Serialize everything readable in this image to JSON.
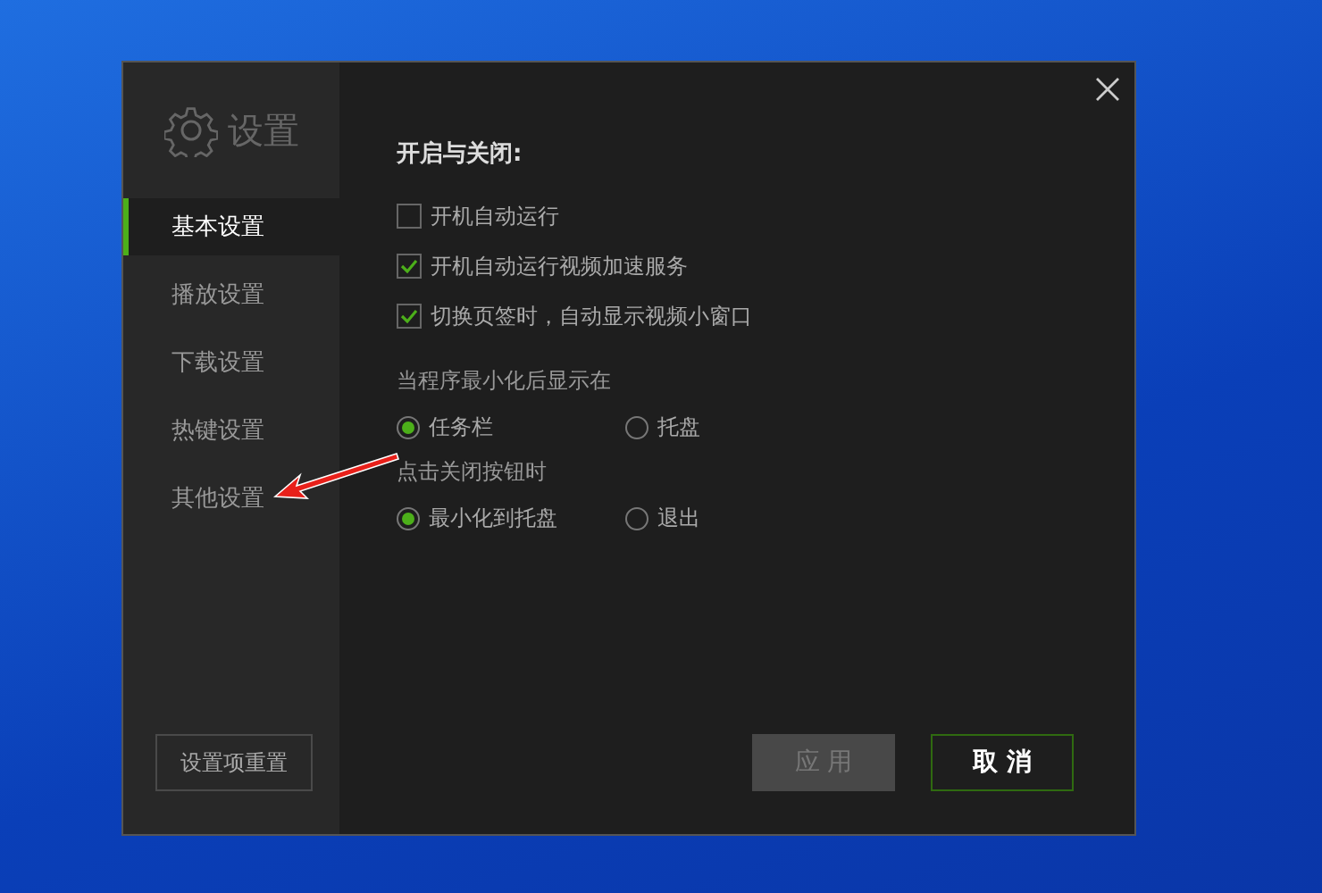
{
  "sidebar": {
    "title": "设置",
    "items": [
      {
        "label": "基本设置",
        "selected": true
      },
      {
        "label": "播放设置",
        "selected": false
      },
      {
        "label": "下载设置",
        "selected": false
      },
      {
        "label": "热键设置",
        "selected": false
      },
      {
        "label": "其他设置",
        "selected": false
      }
    ],
    "reset_button": "设置项重置"
  },
  "section_title": "开启与关闭:",
  "checkboxes": [
    {
      "label": "开机自动运行",
      "checked": false
    },
    {
      "label": "开机自动运行视频加速服务",
      "checked": true
    },
    {
      "label": "切换页签时，自动显示视频小窗口",
      "checked": true
    }
  ],
  "radio_groups": [
    {
      "label": "当程序最小化后显示在",
      "options": [
        {
          "label": "任务栏",
          "selected": true
        },
        {
          "label": "托盘",
          "selected": false
        }
      ]
    },
    {
      "label": "点击关闭按钮时",
      "options": [
        {
          "label": "最小化到托盘",
          "selected": true
        },
        {
          "label": "退出",
          "selected": false
        }
      ]
    }
  ],
  "buttons": [
    {
      "label": "应 用",
      "disabled": true
    },
    {
      "label": "取 消",
      "disabled": false
    }
  ]
}
